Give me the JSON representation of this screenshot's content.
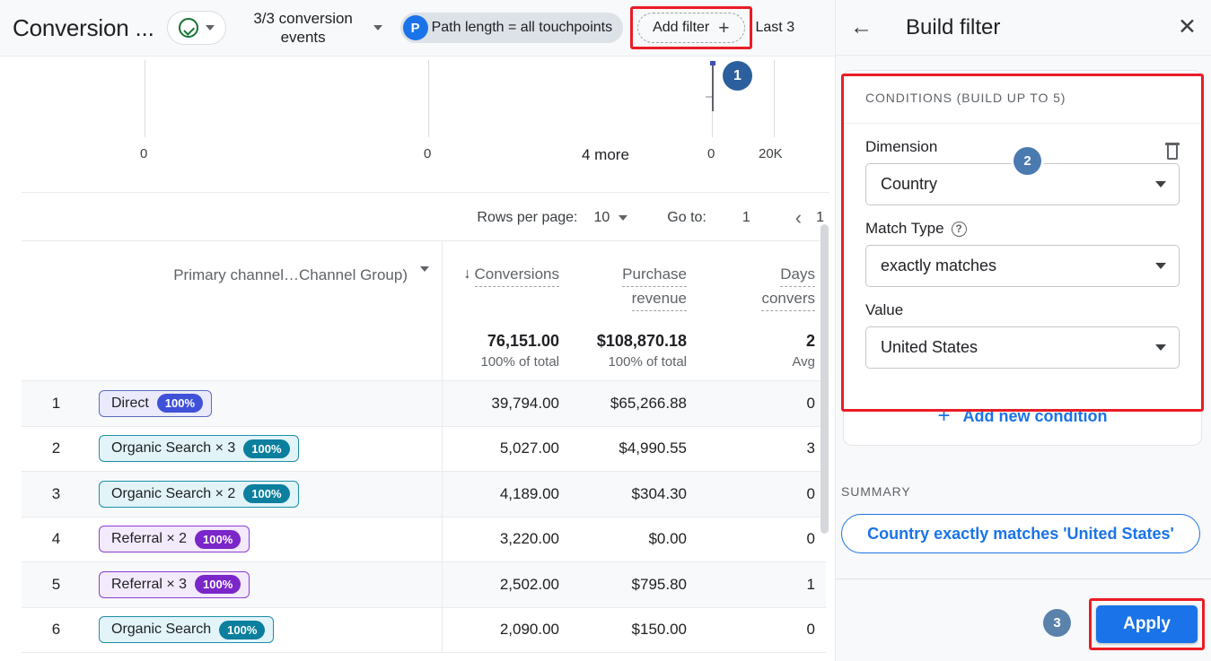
{
  "toolbar": {
    "report_title": "Conversion ...",
    "validation_icon": "check-circle-icon",
    "conversion_events_label": "3/3 conversion events",
    "path_chip_avatar": "P",
    "path_chip_label": "Path length = all touchpoints",
    "add_filter_label": "Add filter",
    "add_filter_plus": "+",
    "date_range_label": "Last 3"
  },
  "chart": {
    "more_label": "4 more",
    "tick_labels": [
      "0",
      "0",
      "0",
      "20K"
    ],
    "step_badge": "1"
  },
  "pagination": {
    "rows_per_page_label": "Rows per page:",
    "rows_per_page_value": "10",
    "goto_label": "Go to:",
    "goto_value": "1",
    "prev_icon": "‹",
    "page_num": "1"
  },
  "table": {
    "dimension_header": "Primary channel…Channel Group)",
    "columns": [
      {
        "label": "Conversions",
        "sorted": true,
        "sort_arrow": "↓"
      },
      {
        "label": "Purchase revenue",
        "sorted": false
      },
      {
        "label": "Days… convers…",
        "sorted": false
      }
    ],
    "totals": [
      {
        "main": "76,151.00",
        "sub": "100% of total"
      },
      {
        "main": "$108,870.18",
        "sub": "100% of total"
      },
      {
        "main": "2",
        "sub": "Avg"
      }
    ],
    "rows": [
      {
        "rank": "1",
        "chip": "Direct",
        "badge": "100%",
        "style": "direct",
        "conversions": "39,794.00",
        "revenue": "$65,266.88",
        "days": "0"
      },
      {
        "rank": "2",
        "chip": "Organic Search × 3",
        "badge": "100%",
        "style": "organic",
        "conversions": "5,027.00",
        "revenue": "$4,990.55",
        "days": "3"
      },
      {
        "rank": "3",
        "chip": "Organic Search × 2",
        "badge": "100%",
        "style": "organic",
        "conversions": "4,189.00",
        "revenue": "$304.30",
        "days": "0"
      },
      {
        "rank": "4",
        "chip": "Referral × 2",
        "badge": "100%",
        "style": "referral",
        "conversions": "3,220.00",
        "revenue": "$0.00",
        "days": "0"
      },
      {
        "rank": "5",
        "chip": "Referral × 3",
        "badge": "100%",
        "style": "referral",
        "conversions": "2,502.00",
        "revenue": "$795.80",
        "days": "1"
      },
      {
        "rank": "6",
        "chip": "Organic Search",
        "badge": "100%",
        "style": "organic",
        "conversions": "2,090.00",
        "revenue": "$150.00",
        "days": "0"
      }
    ]
  },
  "panel": {
    "back_icon": "←",
    "title": "Build filter",
    "close_icon": "✕",
    "conditions_title": "CONDITIONS (BUILD UP TO 5)",
    "dimension_label": "Dimension",
    "dimension_value": "Country",
    "delete_icon": "trash-icon",
    "step_badge_dimension": "2",
    "match_type_label": "Match Type",
    "match_type_help": "?",
    "match_type_value": "exactly matches",
    "value_label": "Value",
    "value_value": "United States",
    "add_condition_plus": "+",
    "add_condition_label": "Add new condition",
    "summary_label": "SUMMARY",
    "summary_chip": "Country exactly matches 'United States'",
    "step_badge_apply": "3",
    "apply_label": "Apply"
  },
  "colors": {
    "accent_blue": "#1a73e8",
    "highlight_red": "#ea1c25",
    "step_badge_blue": "#2c5f9e",
    "chip_direct_bg": "#eaeafc",
    "chip_direct_badge": "#3f51d8",
    "chip_organic_bg": "#e2f4f8",
    "chip_organic_badge": "#0b7f9e",
    "chip_referral_bg": "#f3eafd",
    "chip_referral_badge": "#7b26c9",
    "panel_bg": "#f8f9fa"
  }
}
